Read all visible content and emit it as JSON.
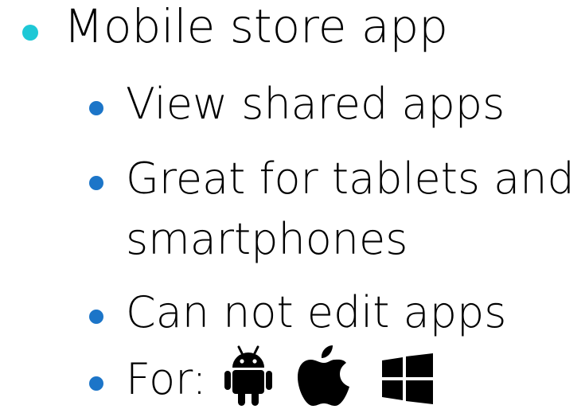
{
  "items": [
    {
      "label": "Mobile store app"
    },
    {
      "label": "View shared apps"
    },
    {
      "label": "Great for tablets and"
    },
    {
      "label": "smartphones"
    },
    {
      "label": "Can not edit apps"
    },
    {
      "label": "For:"
    }
  ],
  "platform_icons": [
    "android-icon",
    "apple-icon",
    "windows-icon"
  ],
  "colors": {
    "level1_bullet": "#1ec8d6",
    "level2_bullet": "#1c75c8",
    "text": "#000000",
    "icons": "#000000"
  }
}
